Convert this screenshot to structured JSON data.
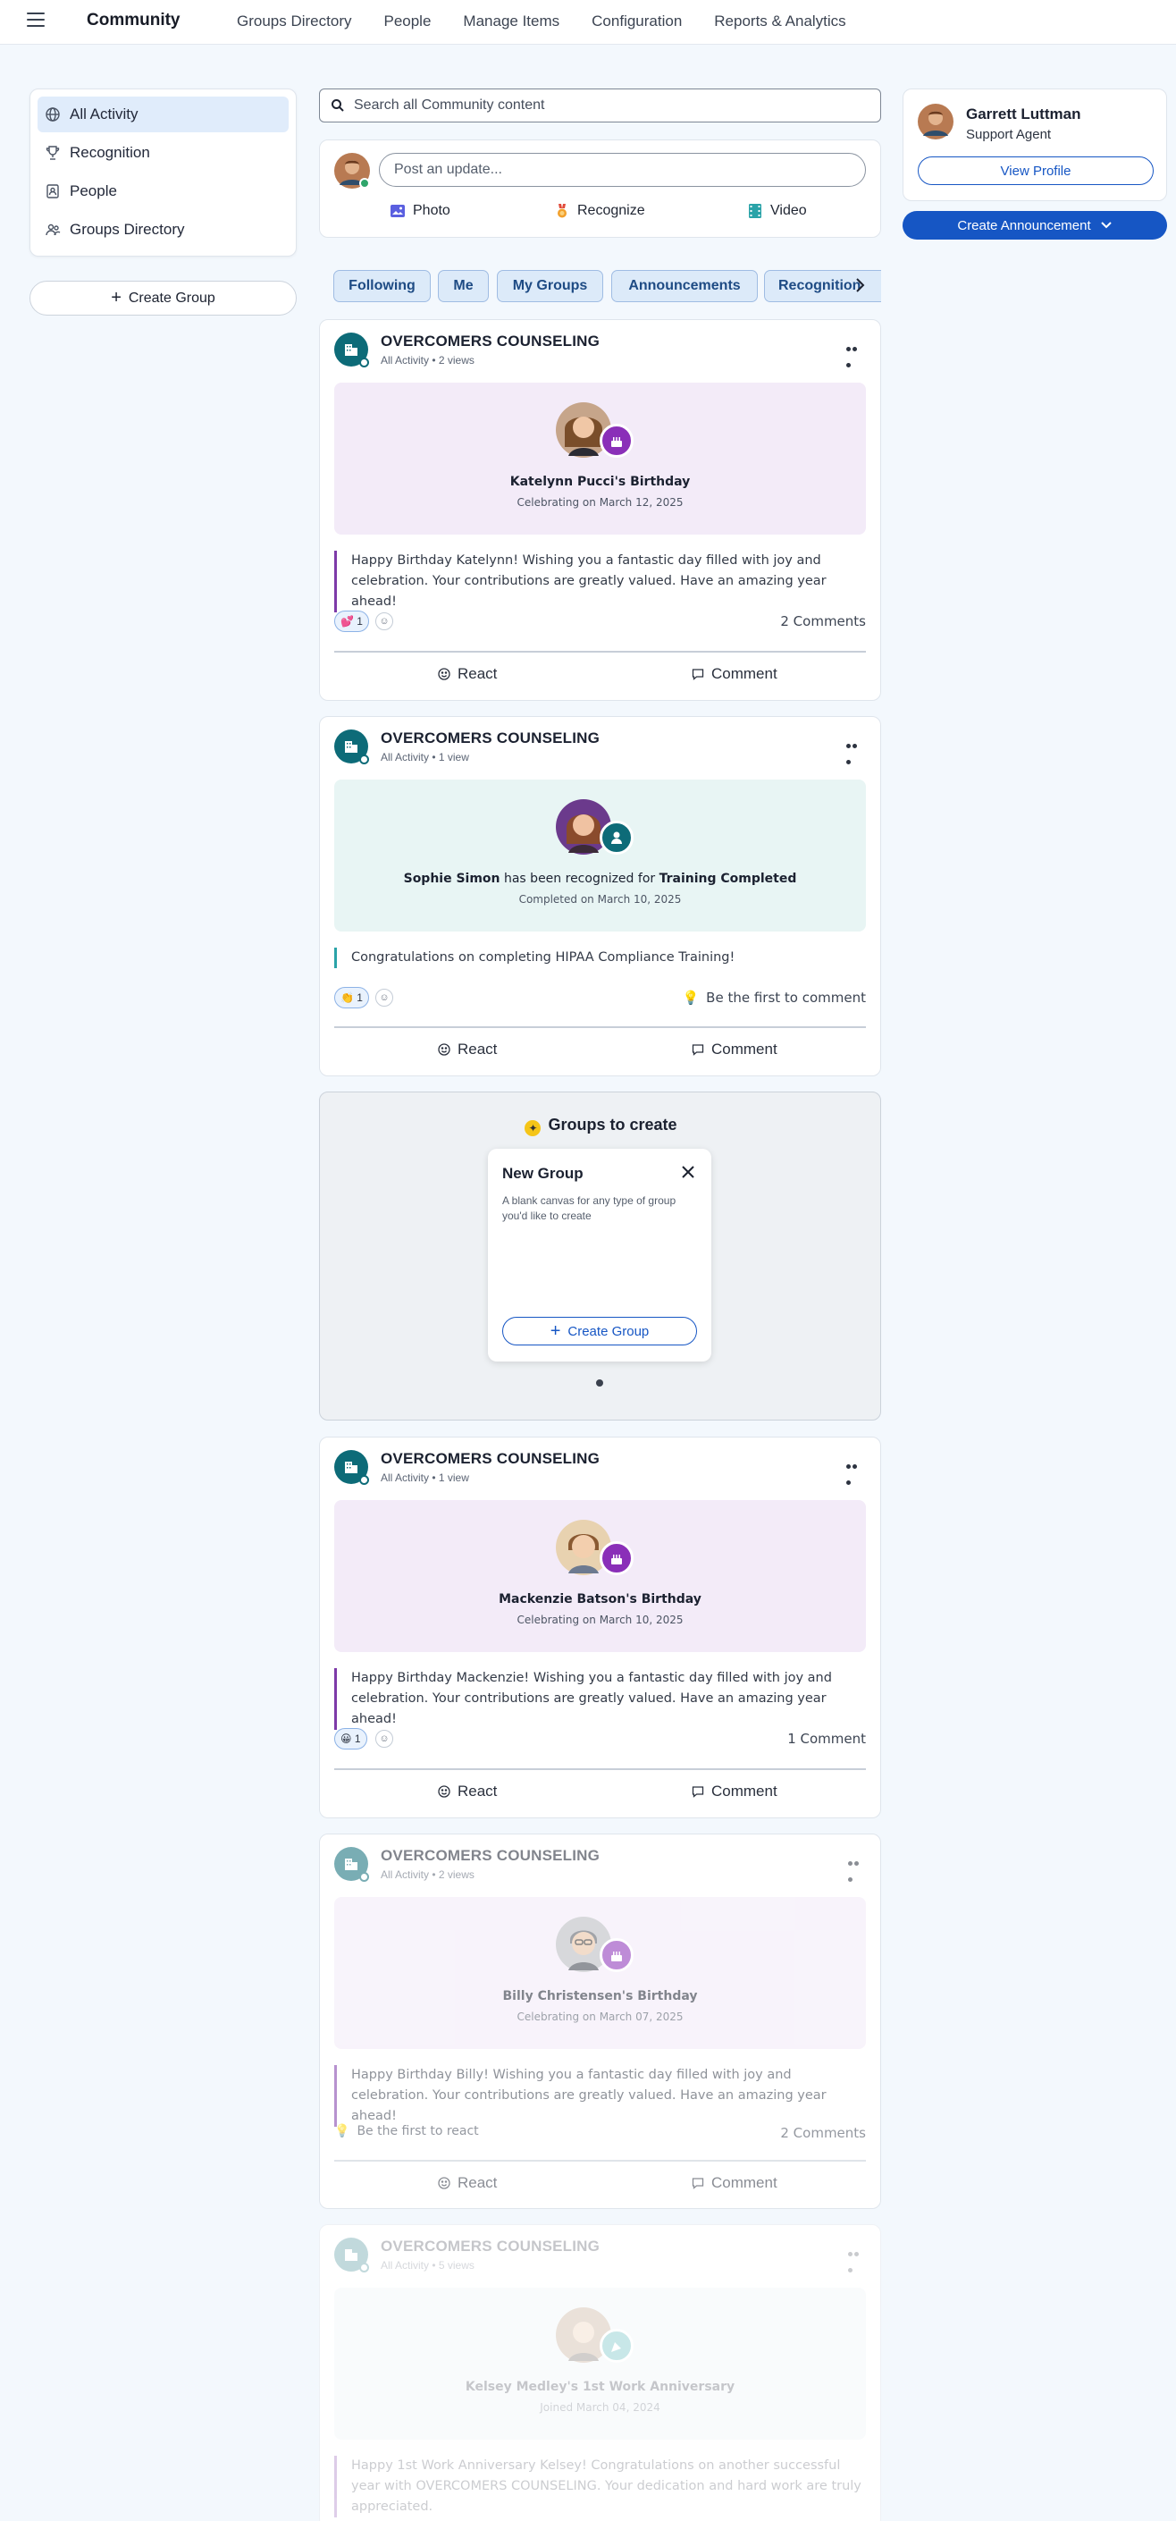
{
  "nav": {
    "brand": "Community",
    "links": [
      "Groups Directory",
      "People",
      "Manage Items",
      "Configuration",
      "Reports & Analytics"
    ]
  },
  "sidebar": {
    "items": [
      {
        "label": "All Activity",
        "icon": "globe-icon",
        "active": true
      },
      {
        "label": "Recognition",
        "icon": "trophy-icon",
        "active": false
      },
      {
        "label": "People",
        "icon": "person-card-icon",
        "active": false
      },
      {
        "label": "Groups Directory",
        "icon": "group-icon",
        "active": false
      }
    ],
    "create_group_label": "Create Group"
  },
  "search": {
    "placeholder": "Search all Community content"
  },
  "composer": {
    "placeholder": "Post an update...",
    "actions": [
      {
        "label": "Photo",
        "icon": "photo-icon"
      },
      {
        "label": "Recognize",
        "icon": "medal-icon"
      },
      {
        "label": "Video",
        "icon": "video-icon"
      }
    ]
  },
  "filters": [
    "Following",
    "Me",
    "My Groups",
    "Announcements",
    "Recognition"
  ],
  "posts": [
    {
      "org": "OVERCOMERS COUNSELING",
      "meta": "All Activity • 2 views",
      "banner_title": "Katelynn Pucci's Birthday",
      "banner_sub": "Celebrating on March 12, 2025",
      "message": "Happy Birthday Katelynn! Wishing you a fantastic day filled with joy and celebration. Your contributions are greatly valued. Have an amazing year ahead!",
      "reaction": "💕 1",
      "comments": "2 Comments"
    },
    {
      "org": "OVERCOMERS COUNSELING",
      "meta": "All Activity • 1 view",
      "banner_name": "Sophie Simon",
      "banner_mid": " has been recognized for ",
      "banner_award": "Training Completed",
      "banner_sub": "Completed on March 10, 2025",
      "message": "Congratulations on completing HIPAA Compliance Training!",
      "reaction": "👏 1",
      "comments": "Be the first to comment"
    },
    {
      "org": "OVERCOMERS COUNSELING",
      "meta": "All Activity • 1 view",
      "banner_title": "Mackenzie Batson's Birthday",
      "banner_sub": "Celebrating on March 10, 2025",
      "message": "Happy Birthday Mackenzie! Wishing you a fantastic day filled with joy and celebration. Your contributions are greatly valued. Have an amazing year ahead!",
      "reaction": "😀 1",
      "comments": "1 Comment"
    },
    {
      "org": "OVERCOMERS COUNSELING",
      "meta": "All Activity • 2 views",
      "banner_title": "Billy Christensen's Birthday",
      "banner_sub": "Celebrating on March 07, 2025",
      "message": "Happy Birthday Billy! Wishing you a fantastic day filled with joy and celebration. Your contributions are greatly valued. Have an amazing year ahead!",
      "reaction": "Be the first to react",
      "comments": "2 Comments"
    },
    {
      "org": "OVERCOMERS COUNSELING",
      "meta": "All Activity • 5 views",
      "banner_title": "Kelsey Medley's 1st Work Anniversary",
      "banner_sub": "Joined March 04, 2024",
      "message": "Happy 1st Work Anniversary Kelsey! Congratulations on another successful year with OVERCOMERS COUNSELING. Your dedication and hard work are truly appreciated."
    }
  ],
  "post_actions": {
    "react": "React",
    "comment": "Comment"
  },
  "groups_to_create": {
    "title": "Groups to create",
    "card_title": "New Group",
    "card_desc": "A blank canvas for any type of group you'd like to create",
    "card_button": "Create Group"
  },
  "profile": {
    "name": "Garrett Luttman",
    "role": "Support Agent",
    "button": "View Profile"
  },
  "announcement_button": "Create Announcement",
  "colors": {
    "accent": "#1656c4",
    "teal": "#0d6b78",
    "purple": "#7d3aa8",
    "birthday_banner": "#f3ebf8",
    "recognition_banner": "#e8f5f4"
  }
}
